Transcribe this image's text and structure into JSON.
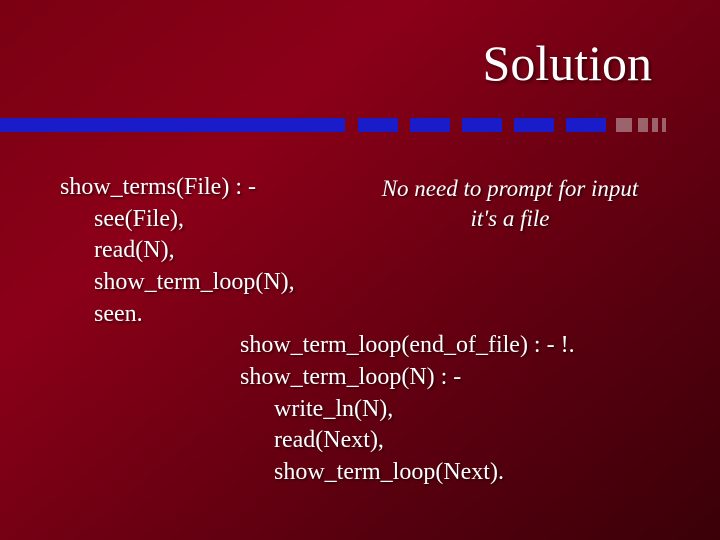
{
  "title": "Solution",
  "annotation": {
    "line1": "No need to prompt for input",
    "line2": "it's a file"
  },
  "code": {
    "l1": "show_terms(File) : -",
    "l2": "see(File),",
    "l3": "read(N),",
    "l4": "show_term_loop(N),",
    "l5": "seen.",
    "l6": "show_term_loop(end_of_file) : - !.",
    "l7": "show_term_loop(N) : -",
    "l8": "write_ln(N),",
    "l9": "read(Next),",
    "l10": "show_term_loop(Next)."
  }
}
